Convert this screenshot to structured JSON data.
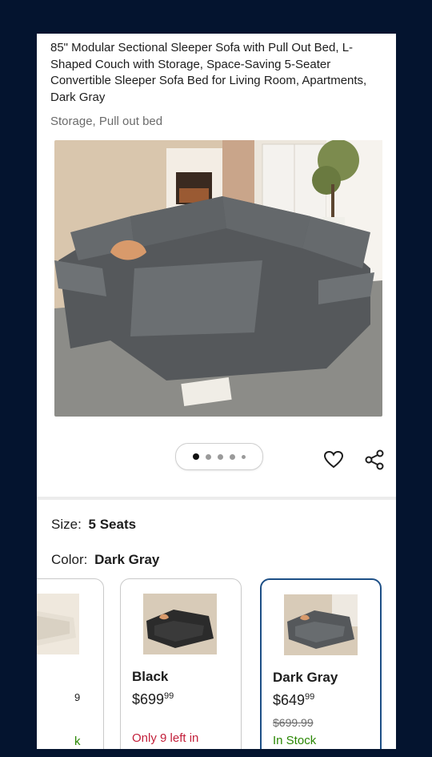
{
  "product": {
    "title": "85\" Modular Sectional Sleeper Sofa with Pull Out Bed, L-Shaped Couch with Storage, Space-Saving 5-Seater Convertible Sleeper Sofa Bed for Living Room, Apartments, Dark Gray",
    "features": "Storage, Pull out bed"
  },
  "gallery": {
    "image_count": 5,
    "active_index": 0
  },
  "actions": {
    "favorite_icon": "heart-icon",
    "share_icon": "share-icon"
  },
  "size": {
    "label": "Size:",
    "value": "5 Seats"
  },
  "color": {
    "label": "Color:",
    "value": "Dark Gray",
    "options": [
      {
        "name": "",
        "price_dollars": "",
        "price_cents": "",
        "was_price": "",
        "stock": "",
        "partial_price": "9",
        "partial_stock": "k",
        "swatch": "#e8e2d8"
      },
      {
        "name": "Black",
        "price_dollars": "$699",
        "price_cents": "99",
        "was_price": "",
        "stock": "Only 9 left in",
        "swatch": "#2d2d2d"
      },
      {
        "name": "Dark Gray",
        "price_dollars": "$649",
        "price_cents": "99",
        "was_price": "$699.99",
        "stock": "In Stock",
        "swatch": "#5a5a5a"
      }
    ]
  },
  "colors": {
    "selected_border": "#1d4f86",
    "low_stock": "#c21f3a",
    "in_stock": "#2a8703",
    "background": "#04142f"
  }
}
